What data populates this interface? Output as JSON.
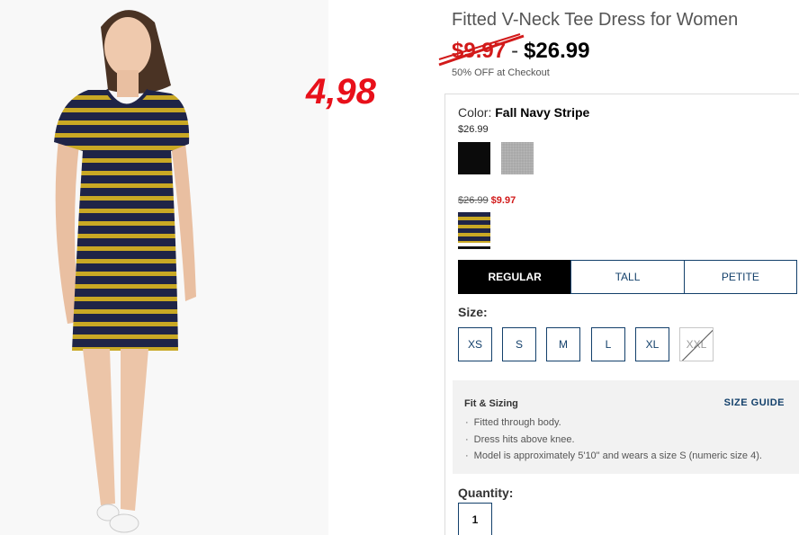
{
  "product": {
    "title": "Fitted V-Neck Tee Dress for Women",
    "old_price": "$9.97",
    "price_separator": "-",
    "price": "$26.99",
    "promo": "50% OFF at Checkout"
  },
  "annotation": "4,98",
  "color": {
    "label": "Color:",
    "selected": "Fall Navy Stripe",
    "regular_price": "$26.99",
    "swatches": [
      {
        "name": "black",
        "color": "#0b0b0b"
      },
      {
        "name": "heather-gray",
        "color": "#a9a9a9"
      }
    ],
    "sale_was": "$26.99",
    "sale_now": "$9.97",
    "sale_swatch": {
      "name": "navy-yellow-stripe",
      "colors": [
        "#1f2447",
        "#c9a824"
      ]
    }
  },
  "fit_types": [
    "REGULAR",
    "TALL",
    "PETITE"
  ],
  "fit_active": "REGULAR",
  "size": {
    "label": "Size:",
    "options": [
      "XS",
      "S",
      "M",
      "L",
      "XL",
      "XXL"
    ],
    "unavailable": [
      "XXL"
    ]
  },
  "fit_sizing": {
    "title": "Fit & Sizing",
    "guide_link": "SIZE GUIDE",
    "bullets": [
      "Fitted through body.",
      "Dress hits above knee.",
      "Model is approximately 5'10\" and wears a size S (numeric size 4)."
    ]
  },
  "quantity": {
    "label": "Quantity:",
    "value": "1"
  },
  "colors": {
    "accent_navy": "#13406b",
    "sale_red": "#d21a1a",
    "annotation_red": "#e8101a"
  }
}
